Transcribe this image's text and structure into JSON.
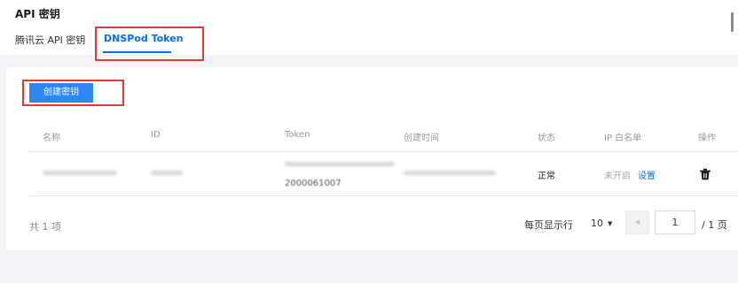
{
  "header": {
    "title": "API 密钥",
    "tabs": [
      {
        "label": "腾讯云 API 密钥",
        "active": false
      },
      {
        "label": "DNSPod Token",
        "active": true
      }
    ]
  },
  "toolbar": {
    "create_label": "创建密钥"
  },
  "table": {
    "columns": [
      "名称",
      "ID",
      "Token",
      "创建时间",
      "状态",
      "IP 白名单",
      "操作"
    ],
    "rows": [
      {
        "token_suffix": "2000061007",
        "status": "正常",
        "ip_whitelist": "未开启",
        "ip_action": "设置",
        "action_icon": "trash-icon"
      }
    ]
  },
  "pagination": {
    "total": "共 1 项",
    "per_page_label": "每页显示行",
    "page_size": "10",
    "current_page": "1",
    "total_pages": "/ 1 页"
  },
  "colors": {
    "accent": "#006eff",
    "button": "#2e87f5",
    "highlight": "#e53935"
  }
}
